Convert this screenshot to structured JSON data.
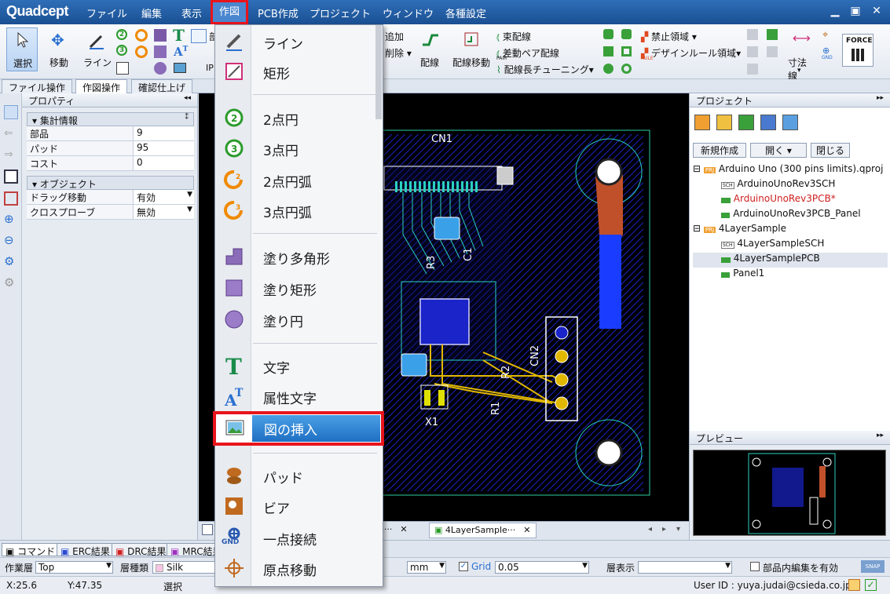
{
  "app": {
    "logo": "Quadcept"
  },
  "menu": {
    "file": "ファイル",
    "edit": "編集",
    "view": "表示",
    "draw": "作図",
    "pcb": "PCB作成",
    "project": "プロジェクト",
    "window": "ウィンドウ",
    "settings": "各種設定"
  },
  "ribbon": {
    "select": "選択",
    "move": "移動",
    "line": "ライン",
    "add": "追加",
    "delete": "削除",
    "wiring": "配線",
    "wiring_move": "配線移動",
    "bundle": "束配線",
    "diff_pair": "差動ペア配線",
    "length_tune": "配線長チューニング",
    "keepout": "禁止領域",
    "design_rule_area": "デザインルール領域",
    "dimension": "寸法線",
    "force": "FORCE",
    "pair_icon_text": "PAIR",
    "rule_icon_text": "RULE",
    "gnd_icon_text": "GND",
    "ip_text": "IP",
    "partial_char": "部"
  },
  "ribbon_tabs": {
    "file_ops": "ファイル操作",
    "draw_ops": "作図操作",
    "confirm": "確認仕上げ"
  },
  "properties": {
    "title": "プロパティ",
    "summary_group": "集計情報",
    "parts_label": "部品",
    "parts_value": "9",
    "pads_label": "パッド",
    "pads_value": "95",
    "cost_label": "コスト",
    "cost_value": "0",
    "object_group": "オブジェクト",
    "drag_label": "ドラッグ移動",
    "drag_value": "有効",
    "probe_label": "クロスプローブ",
    "probe_value": "無効"
  },
  "project": {
    "title": "プロジェクト",
    "new": "新規作成",
    "open": "開く",
    "close": "閉じる",
    "items": [
      {
        "label": "Arduino Uno (300 pins limits).qproj",
        "icon": "PRJ"
      },
      {
        "label": "ArduinoUnoRev3SCH",
        "icon": "SCH"
      },
      {
        "label": "ArduinoUnoRev3PCB*",
        "icon": "PCB"
      },
      {
        "label": "ArduinoUnoRev3PCB_Panel",
        "icon": "PNL"
      },
      {
        "label": "4LayerSample",
        "icon": "PRJ"
      },
      {
        "label": "4LayerSampleSCH",
        "icon": "SCH"
      },
      {
        "label": "4LayerSamplePCB",
        "icon": "PCB"
      },
      {
        "label": "Panel1",
        "icon": "PNL"
      }
    ]
  },
  "preview": {
    "title": "プレビュー"
  },
  "canvas": {
    "cn1": "CN1",
    "cn2": "CN2",
    "r1": "R1",
    "r2": "R2",
    "r3": "R3",
    "c1": "C1",
    "x1": "X1"
  },
  "doc_tabs": {
    "tab1": "le···",
    "tab2": "4LayerSample···"
  },
  "bottom_tabs": {
    "command": "コマンド",
    "erc": "ERC結果",
    "drc": "DRC結果",
    "mrc": "MRC結果"
  },
  "layerbar": {
    "work_layer_label": "作業層",
    "work_layer_value": "Top",
    "layer_type_label": "層種類",
    "layer_type_value": "Silk",
    "unit_value": "mm",
    "grid_label": "Grid",
    "grid_value": "0.05",
    "layer_display_label": "層表示",
    "layer_display_value": "",
    "part_edit_label": "部品内編集を有効",
    "snap": "SNAP"
  },
  "status": {
    "x": "X:25.6",
    "y": "Y:47.35",
    "mode": "選択",
    "user": "User ID : yuya.judai@csieda.co.jp"
  },
  "dropdown": {
    "line": "ライン",
    "rect": "矩形",
    "circle2": "2点円",
    "circle3": "3点円",
    "arc2": "2点円弧",
    "arc3": "3点円弧",
    "fill_poly": "塗り多角形",
    "fill_rect": "塗り矩形",
    "fill_circle": "塗り円",
    "text": "文字",
    "attr_text": "属性文字",
    "insert_image": "図の挿入",
    "pad": "パッド",
    "via": "ビア",
    "single_point": "一点接続",
    "origin_move": "原点移動",
    "gnd_icon_text": "GND"
  },
  "colors": {
    "title_bar": "#1f5aa3",
    "highlight": "#2d7fd3",
    "annotation": "#e8141b",
    "pcb_bg": "#000000",
    "pcb_trace": "#e0b800",
    "pcb_copper": "#1a24c8"
  }
}
